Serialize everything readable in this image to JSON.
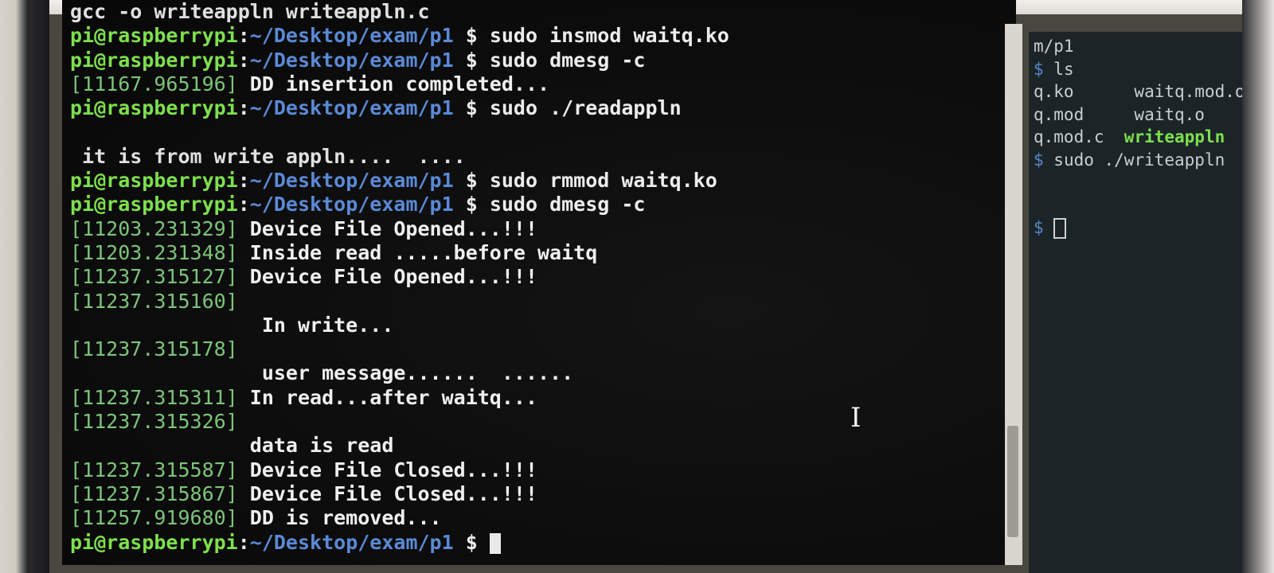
{
  "main_terminal": {
    "lines": [
      {
        "kind": "plain",
        "text": "gcc -o writeappln writeappln.c"
      },
      {
        "kind": "prompt",
        "user": "pi@raspberrypi",
        "sep": ":",
        "path": "~/Desktop/exam/p1",
        "dollar": " $ ",
        "cmd": "sudo insmod waitq.ko"
      },
      {
        "kind": "prompt",
        "user": "pi@raspberrypi",
        "sep": ":",
        "path": "~/Desktop/exam/p1",
        "dollar": " $ ",
        "cmd": "sudo dmesg -c"
      },
      {
        "kind": "log",
        "ts": "[11167.965196]",
        "msg": " DD insertion completed..."
      },
      {
        "kind": "prompt",
        "user": "pi@raspberrypi",
        "sep": ":",
        "path": "~/Desktop/exam/p1",
        "dollar": " $ ",
        "cmd": "sudo ./readappln"
      },
      {
        "kind": "blank",
        "text": ""
      },
      {
        "kind": "plain",
        "text": " it is from write appln....  ...."
      },
      {
        "kind": "prompt",
        "user": "pi@raspberrypi",
        "sep": ":",
        "path": "~/Desktop/exam/p1",
        "dollar": " $ ",
        "cmd": "sudo rmmod waitq.ko"
      },
      {
        "kind": "prompt",
        "user": "pi@raspberrypi",
        "sep": ":",
        "path": "~/Desktop/exam/p1",
        "dollar": " $ ",
        "cmd": "sudo dmesg -c"
      },
      {
        "kind": "log",
        "ts": "[11203.231329]",
        "msg": " Device File Opened...!!!"
      },
      {
        "kind": "log",
        "ts": "[11203.231348]",
        "msg": " Inside read .....before waitq"
      },
      {
        "kind": "log",
        "ts": "[11237.315127]",
        "msg": " Device File Opened...!!!"
      },
      {
        "kind": "log",
        "ts": "[11237.315160]",
        "msg": ""
      },
      {
        "kind": "msgonly",
        "text": "                In write..."
      },
      {
        "kind": "log",
        "ts": "[11237.315178]",
        "msg": ""
      },
      {
        "kind": "msgonly",
        "text": "                user message......  ......"
      },
      {
        "kind": "log",
        "ts": "[11237.315311]",
        "msg": " In read...after waitq..."
      },
      {
        "kind": "log",
        "ts": "[11237.315326]",
        "msg": ""
      },
      {
        "kind": "msgonly",
        "text": "               data is read"
      },
      {
        "kind": "log",
        "ts": "[11237.315587]",
        "msg": " Device File Closed...!!!"
      },
      {
        "kind": "log",
        "ts": "[11237.315867]",
        "msg": " Device File Closed...!!!"
      },
      {
        "kind": "log",
        "ts": "[11257.919680]",
        "msg": " DD is removed..."
      },
      {
        "kind": "prompt_cursor",
        "user": "pi@raspberrypi",
        "sep": ":",
        "path": "~/Desktop/exam/p1",
        "dollar": " $ ",
        "cmd": ""
      }
    ]
  },
  "side_terminal": {
    "lines": [
      {
        "parts": [
          {
            "c": "plain",
            "t": "m/p1"
          }
        ]
      },
      {
        "parts": [
          {
            "c": "blue",
            "t": "$ "
          },
          {
            "c": "plain",
            "t": "ls"
          }
        ]
      },
      {
        "parts": [
          {
            "c": "plain",
            "t": "q.ko      waitq.mod.o"
          }
        ]
      },
      {
        "parts": [
          {
            "c": "plain",
            "t": "q.mod     waitq.o"
          }
        ]
      },
      {
        "parts": [
          {
            "c": "plain",
            "t": "q.mod.c  "
          },
          {
            "c": "green",
            "t": "writeappln"
          }
        ]
      },
      {
        "parts": [
          {
            "c": "blue",
            "t": "$ "
          },
          {
            "c": "plain",
            "t": "sudo ./writeappln"
          }
        ]
      },
      {
        "parts": [
          {
            "c": "plain",
            "t": ""
          }
        ]
      },
      {
        "parts": [
          {
            "c": "plain",
            "t": ""
          }
        ]
      },
      {
        "parts": [
          {
            "c": "blue",
            "t": "$ "
          },
          {
            "c": "cursor",
            "t": ""
          }
        ]
      }
    ]
  }
}
